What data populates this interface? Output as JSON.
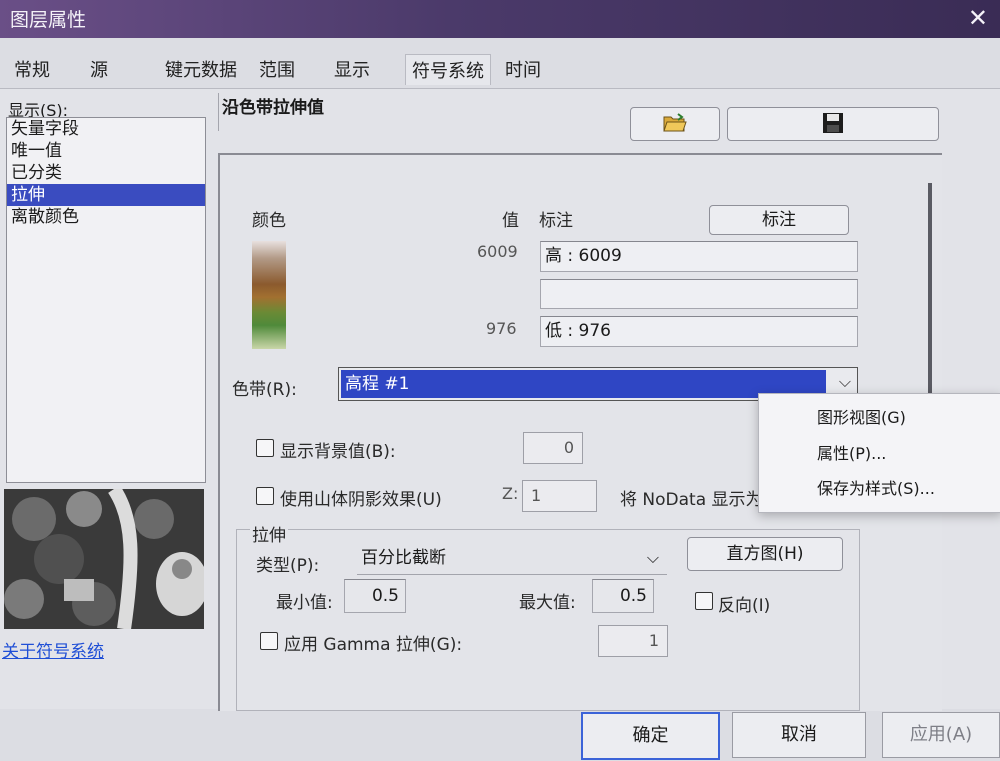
{
  "window": {
    "title": "图层属性",
    "close_glyph": "✕"
  },
  "tabs": [
    {
      "label": "常规"
    },
    {
      "label": "源"
    },
    {
      "label": "键元数据"
    },
    {
      "label": "范围"
    },
    {
      "label": "显示"
    },
    {
      "label": "符号系统",
      "active": true
    },
    {
      "label": "时间"
    }
  ],
  "left_panel": {
    "show_label": "显示(S):",
    "items": [
      "矢量字段",
      "唯一值",
      "已分类",
      "拉伸",
      "离散颜色"
    ],
    "selected_index": 3,
    "about_link": "关于符号系统"
  },
  "section": {
    "title": "沿色带拉伸值",
    "open_icon": "folder-open-icon",
    "save_icon": "floppy-disk-icon"
  },
  "legend": {
    "color_header": "颜色",
    "value_header": "值",
    "label_header": "标注",
    "label_button": "标注",
    "high_value": "6009",
    "high_label": "高 : 6009",
    "mid_label": "",
    "low_value": "976",
    "low_label": "低 : 976"
  },
  "color_ramp": {
    "label": "色带(R):",
    "value": "高程 #1"
  },
  "background": {
    "label": "显示背景值(B):",
    "value": "0",
    "checked": false
  },
  "hillshade": {
    "label": "使用山体阴影效果(U)",
    "z_label": "Z:",
    "z_value": "1",
    "checked": false
  },
  "nodata": {
    "label": "将 NoData 显示为"
  },
  "stretch": {
    "group_label": "拉伸",
    "type_label": "类型(P):",
    "type_value": "百分比截断",
    "histogram_button": "直方图(H)",
    "min_label": "最小值:",
    "min_value": "0.5",
    "max_label": "最大值:",
    "max_value": "0.5",
    "invert_label": "反向(I)",
    "invert_checked": false,
    "gamma_label": "应用 Gamma 拉伸(G):",
    "gamma_value": "1",
    "gamma_checked": false
  },
  "context_menu": {
    "items": [
      "图形视图(G)",
      "属性(P)...",
      "保存为样式(S)..."
    ]
  },
  "buttons": {
    "ok": "确定",
    "cancel": "取消",
    "apply": "应用(A)"
  },
  "colors": {
    "accent": "#2f46c4",
    "title_bar": "#4b3a6a",
    "link": "#1f4fd6"
  }
}
